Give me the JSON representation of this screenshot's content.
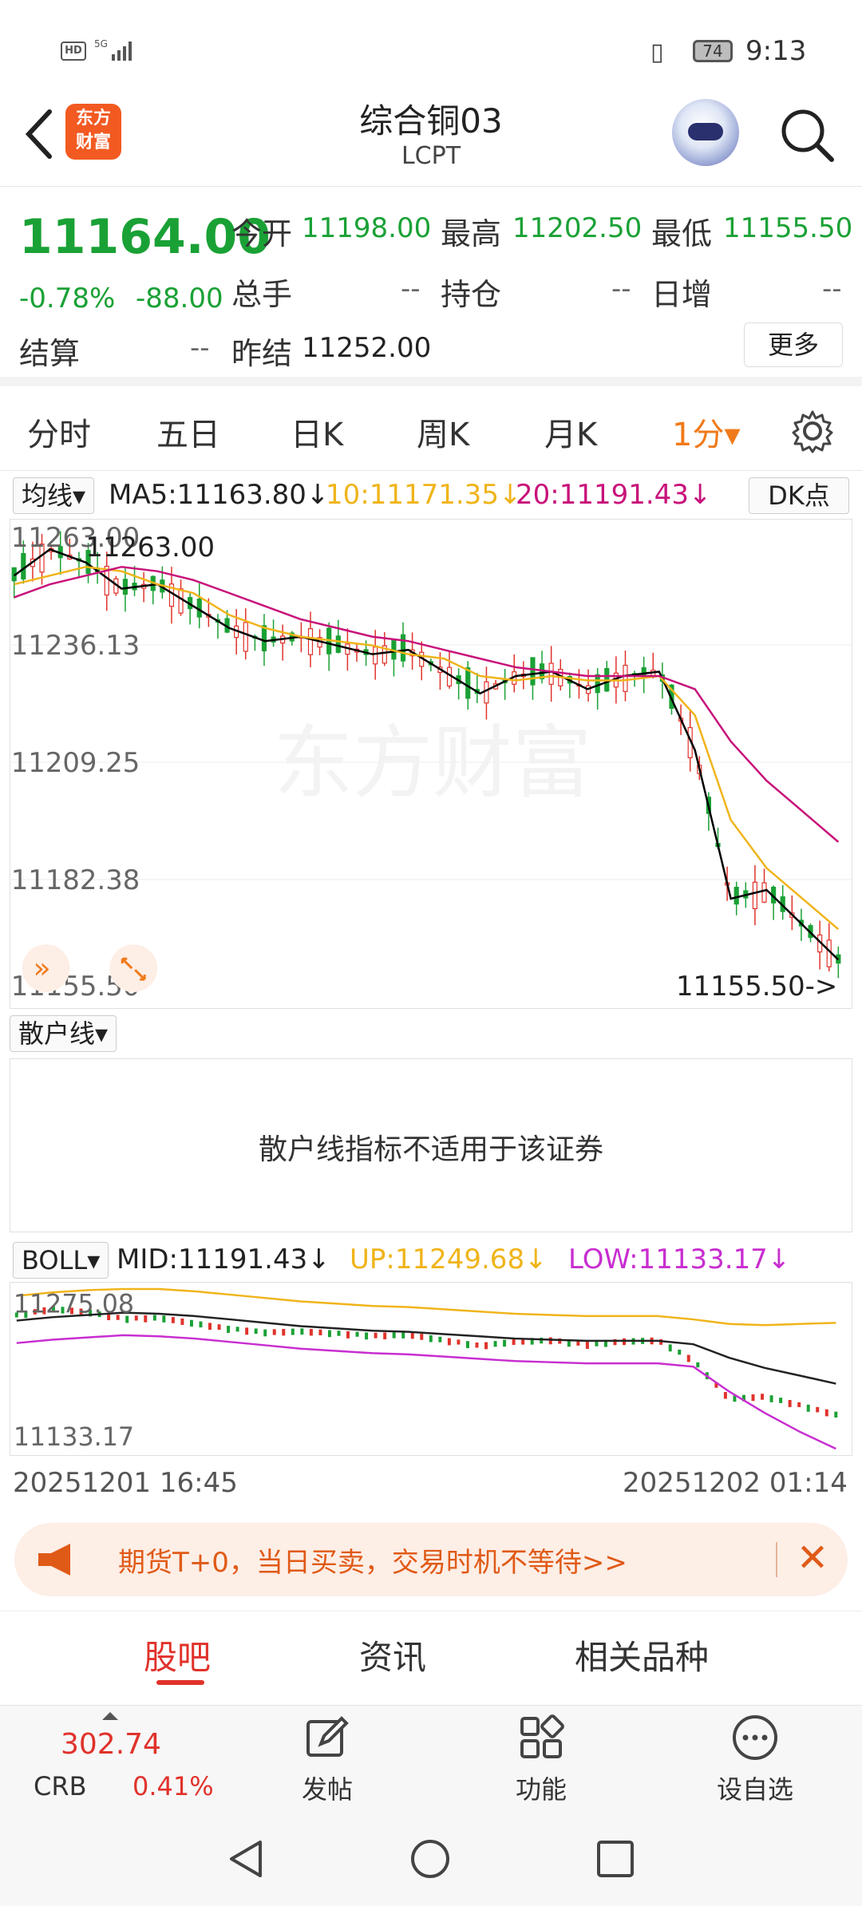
{
  "status_bar": {
    "hd": "HD",
    "signal": "5G",
    "battery": "74",
    "time": "9:13"
  },
  "header": {
    "logo_line1": "东方",
    "logo_line2": "财富",
    "title": "综合铜03",
    "subtitle": "LCPT"
  },
  "quote": {
    "price": "11164.00",
    "change_pct": "-0.78%",
    "change_val": "-88.00",
    "open_label": "今开",
    "open_value": "11198.00",
    "high_label": "最高",
    "high_value": "11202.50",
    "low_label": "最低",
    "low_value": "11155.50",
    "volume_label": "总手",
    "volume_value": "--",
    "position_label": "持仓",
    "position_value": "--",
    "daily_inc_label": "日增",
    "daily_inc_value": "--",
    "settle_label": "结算",
    "settle_value": "--",
    "prev_settle_label": "昨结",
    "prev_settle_value": "11252.00",
    "more_label": "更多"
  },
  "tabs": {
    "items": [
      "分时",
      "五日",
      "日K",
      "周K",
      "月K"
    ],
    "active": "1分▾"
  },
  "ma_bar": {
    "selector": "均线▾",
    "ma5": "MA5:11163.80↓",
    "ma10": "10:11171.35↓",
    "ma20": "20:11191.43↓",
    "dk": "DK点"
  },
  "main_chart": {
    "y_ticks": [
      "11263.00",
      "11236.13",
      "11209.25",
      "11182.38",
      "11155.50"
    ],
    "max_label": "11263.00",
    "min_label": "11155.50->",
    "watermark": "东方财富"
  },
  "retail": {
    "selector": "散户线▾",
    "message": "散户线指标不适用于该证券"
  },
  "boll": {
    "selector": "BOLL▾",
    "mid": "MID:11191.43↓",
    "up": "UP:11249.68↓",
    "low": "LOW:11133.17↓",
    "y_top": "11275.08",
    "y_bottom": "11133.17"
  },
  "time_axis": {
    "start": "20251201 16:45",
    "end": "20251202 01:14"
  },
  "promo": {
    "text": "期货T+0，当日买卖，交易时机不等待>>"
  },
  "bottom_tabs": {
    "items": [
      "股吧",
      "资讯",
      "相关品种"
    ]
  },
  "bottom_bar": {
    "crb_value": "302.74",
    "crb_label": "CRB",
    "crb_pct": "0.41%",
    "post": "发帖",
    "func": "功能",
    "watch": "设自选"
  },
  "colors": {
    "down": "#1aa135",
    "up": "#e0322b",
    "accent": "#f07a1a",
    "ma5": "#000000",
    "ma10": "#f0b41a",
    "ma20": "#c8127a"
  },
  "chart_data": {
    "type": "line",
    "ylim": [
      11155.5,
      11263.0
    ],
    "x_range": [
      "20251201 16:45",
      "20251202 01:14"
    ],
    "series": [
      {
        "name": "MA5",
        "last": 11163.8,
        "values": [
          11252,
          11258,
          11255,
          11249,
          11250,
          11245,
          11240,
          11237,
          11238,
          11236,
          11234,
          11235,
          11230,
          11225,
          11229,
          11230,
          11226,
          11229,
          11230,
          11212,
          11178,
          11180,
          11172,
          11164
        ]
      },
      {
        "name": "MA10",
        "last": 11171.35,
        "values": [
          11250,
          11252,
          11254,
          11253,
          11250,
          11248,
          11243,
          11240,
          11238,
          11237,
          11236,
          11234,
          11233,
          11229,
          11228,
          11229,
          11228,
          11228,
          11229,
          11220,
          11196,
          11185,
          11178,
          11171
        ]
      },
      {
        "name": "MA20",
        "last": 11191.43,
        "values": [
          11247,
          11250,
          11252,
          11254,
          11253,
          11251,
          11248,
          11245,
          11242,
          11240,
          11238,
          11237,
          11235,
          11233,
          11231,
          11230,
          11229,
          11229,
          11229,
          11226,
          11214,
          11205,
          11198,
          11191
        ]
      }
    ],
    "last_price": 11164.0,
    "low": 11155.5,
    "high": 11263.0
  }
}
